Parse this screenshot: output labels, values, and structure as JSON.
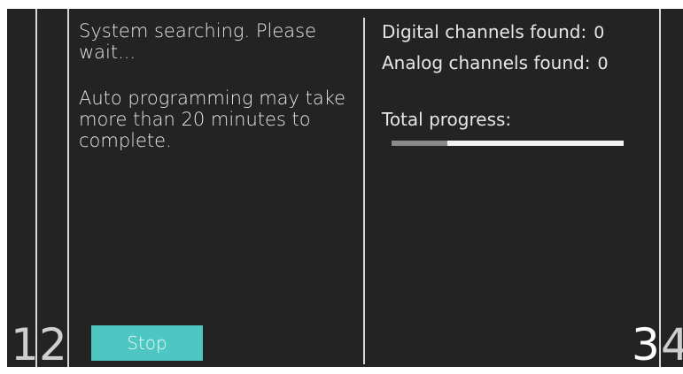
{
  "dialog": {
    "message_searching": "System searching. Please wait...",
    "message_duration": "Auto programming may take more than 20 minutes to complete.",
    "stop_label": "Stop"
  },
  "status": {
    "digital_label": "Digital channels found:",
    "digital_count": "0",
    "analog_label": "Analog channels found:",
    "analog_count": "0",
    "progress_label": "Total progress:",
    "progress_fraction": 0.24
  },
  "callouts": {
    "n1": "1",
    "n2": "2",
    "n3": "3",
    "n4": "4"
  },
  "colors": {
    "screen_bg": "#232323",
    "text": "#e6e6e6",
    "button_bg": "#4ec6c2",
    "progress_track": "#f2f2f2",
    "progress_fill": "#8a8a8a"
  }
}
